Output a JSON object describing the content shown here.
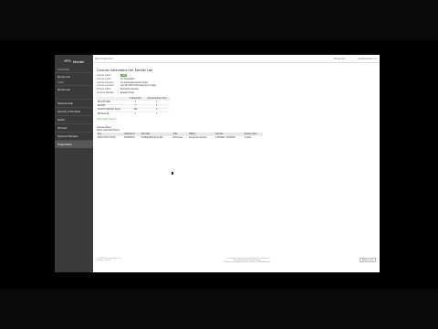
{
  "brand": {
    "name": "Meraki",
    "accent": "#6ab04c",
    "sidebar_bg": "#3a3a3a"
  },
  "sidebar": {
    "groups": [
      {
        "label": "NETWORK",
        "items": [
          {
            "label": "Meraki Lab"
          }
        ]
      },
      {
        "label": "VIEW",
        "items": [
          {
            "label": "Meraki Lab"
          }
        ]
      }
    ],
    "nav": [
      {
        "label": "Network-wide"
      },
      {
        "label": "Security & SD-WAN"
      },
      {
        "label": "Switch"
      },
      {
        "label": "Wireless"
      },
      {
        "label": "Systems Manager"
      },
      {
        "label": "Organization"
      }
    ]
  },
  "topbar": {
    "back_label": "Back to dashboard",
    "network_label": "Meraki Lab",
    "user_label": "user@example.com"
  },
  "page": {
    "title": "License information for Meraki Lab",
    "fields": [
      {
        "key": "License status",
        "value": "OK",
        "badge": true
      },
      {
        "key": "License model",
        "value": "Co-termination",
        "green": true
      },
      {
        "key": "Licensed devices",
        "value": "Co-termination license limits",
        "green": true
      },
      {
        "key": "License expiration",
        "value": "Jan 28, 2024 (1923 days from today)"
      },
      {
        "key": "Product edition",
        "value": "Enterprise Security"
      },
      {
        "key": "Systems Manager",
        "value": "Enabled (free)"
      }
    ],
    "license_table": {
      "headers": [
        "",
        "License limit",
        "Current device count"
      ],
      "rows": [
        [
          "MX-ENT-SEC",
          "1",
          "1"
        ],
        [
          "MX64W",
          "1",
          "1"
        ],
        [
          "Systems Manager Agent",
          "100",
          "0"
        ],
        [
          "Wireless AP",
          "1",
          "1"
        ]
      ]
    },
    "link_label": "Add another license",
    "history_title": "License history",
    "history_sub": "Show expanded history",
    "history_table": {
      "headers": [
        "Key",
        "Claimed on",
        "Start date",
        "Type",
        "Edition",
        "Devices",
        "License Term"
      ],
      "rows": [
        [
          "Z2XX-XXXX-XXXX",
          "01/28/2019",
          "01/28/2019 8:44:23 AM",
          "MX license",
          "Enterprise Security",
          "1 MX64W, 1 MX64W",
          "3 years"
        ]
      ]
    }
  },
  "footer": {
    "left_line1": "© 2019 Cisco Systems, Inc.",
    "left_line2": "Privacy · Terms",
    "mid_line1": "Last login: today from your current IP address",
    "mid_line2": "Current session started: today",
    "mid_line3": "Data for this organization is hosted in North America",
    "button_label": "Make a wish"
  }
}
